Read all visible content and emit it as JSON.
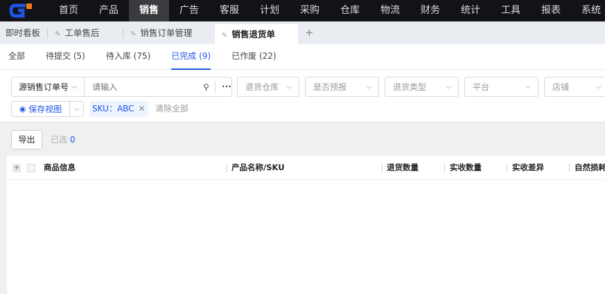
{
  "nav": {
    "items": [
      "首页",
      "产品",
      "销售",
      "广告",
      "客服",
      "计划",
      "采购",
      "仓库",
      "物流",
      "财务",
      "统计",
      "工具",
      "报表",
      "系统"
    ],
    "active": "销售",
    "accent": "#1d55e6"
  },
  "tabs": {
    "items": [
      "即时看板",
      "工单售后",
      "销售订单管理",
      "销售退货单"
    ],
    "active": "销售退货单",
    "add": "+"
  },
  "status_tabs": [
    "全部",
    "待提交 (5)",
    "待入库 (75)",
    "已完成 (9)",
    "已作废 (22)"
  ],
  "filters": {
    "search_type": "源销售订单号",
    "search_placeholder": "请输入",
    "more": "•••",
    "dropdowns": [
      "退货仓库",
      "是否预报",
      "退货类型",
      "平台",
      "店铺"
    ],
    "save_view": "保存视图",
    "tag": "SKU：ABC",
    "clear_all": "清除全部"
  },
  "toolbar": {
    "export": "导出",
    "selected_label": "已选",
    "selected_count": "0"
  },
  "table": {
    "columns": [
      "商品信息",
      "产品名称/SKU",
      "退货数量",
      "实收数量",
      "实收差异",
      "自然损耗"
    ]
  }
}
